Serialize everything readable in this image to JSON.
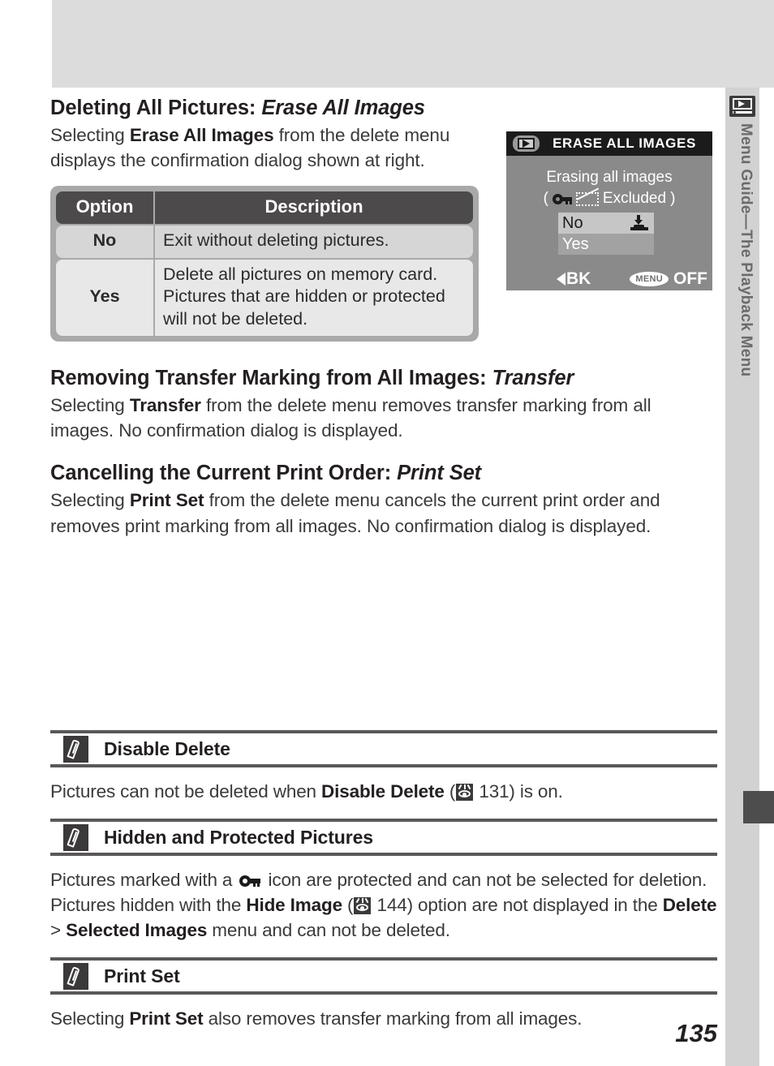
{
  "page": {
    "number": "135",
    "sidebar_label": "Menu Guide—The Playback Menu",
    "sidebar_icon": "playback-icon"
  },
  "sections": [
    {
      "heading_plain": "Deleting All Pictures: ",
      "heading_italic": "Erase All Images",
      "body_parts": [
        {
          "t": "Selecting ",
          "b": false
        },
        {
          "t": "Erase All Images",
          "b": true
        },
        {
          "t": " from the delete menu displays the confirmation dialog shown at right.",
          "b": false
        }
      ]
    },
    {
      "heading_plain": "Removing Transfer Marking from All Images: ",
      "heading_italic": "Transfer",
      "body_parts": [
        {
          "t": "Selecting ",
          "b": false
        },
        {
          "t": "Transfer",
          "b": true
        },
        {
          "t": " from the delete menu removes transfer marking from all images.  No confirmation dialog is displayed.",
          "b": false
        }
      ]
    },
    {
      "heading_plain": "Cancelling the Current Print Order: ",
      "heading_italic": "Print Set",
      "body_parts": [
        {
          "t": "Selecting ",
          "b": false
        },
        {
          "t": "Print Set",
          "b": true
        },
        {
          "t": " from the delete menu cancels the current print order and removes print marking from all images.  No confirmation dialog is displayed.",
          "b": false
        }
      ]
    }
  ],
  "option_table": {
    "headers": [
      "Option",
      "Description"
    ],
    "rows": [
      {
        "option": "No",
        "description": "Exit without deleting pictures."
      },
      {
        "option": "Yes",
        "description": "Delete all pictures on memory card. Pictures that are hidden or protected will not be deleted."
      }
    ]
  },
  "lcd": {
    "title": "ERASE ALL IMAGES",
    "line1": "Erasing all images",
    "paren_open": "(",
    "excluded_label": "Excluded",
    "paren_close": ")",
    "option_no": "No",
    "option_yes": "Yes",
    "back_label": "BK",
    "menu_badge": "MENU",
    "menu_state": "OFF",
    "icons": {
      "playback": "playback-icon",
      "key": "protect-key-icon",
      "hidden": "hidden-image-icon",
      "press": "press-shutter-icon"
    }
  },
  "notes": [
    {
      "title": "Disable Delete",
      "icon": "pencil-icon",
      "parts": [
        {
          "t": "Pictures can not be deleted when ",
          "b": false
        },
        {
          "t": "Disable Delete",
          "b": true
        },
        {
          "t": " (",
          "b": false
        },
        {
          "ref": "131"
        },
        {
          "t": ") is on.",
          "b": false
        }
      ]
    },
    {
      "title": "Hidden and Protected Pictures",
      "icon": "pencil-icon",
      "parts": [
        {
          "t": "Pictures marked with a ",
          "b": false
        },
        {
          "key": true
        },
        {
          "t": " icon are protected and can not be selected for deletion.  Pictures hidden with the ",
          "b": false
        },
        {
          "t": "Hide Image",
          "b": true
        },
        {
          "t": " (",
          "b": false
        },
        {
          "ref": "144"
        },
        {
          "t": ") option are not displayed in the ",
          "b": false
        },
        {
          "t": "Delete",
          "b": true
        },
        {
          "t": " > ",
          "b": false
        },
        {
          "t": "Selected Images",
          "b": true
        },
        {
          "t": " menu and can not be deleted.",
          "b": false
        }
      ]
    },
    {
      "title": "Print Set",
      "icon": "pencil-icon",
      "parts": [
        {
          "t": "Selecting ",
          "b": false
        },
        {
          "t": "Print Set",
          "b": true
        },
        {
          "t": " also removes transfer marking from all images.",
          "b": false
        }
      ]
    }
  ]
}
